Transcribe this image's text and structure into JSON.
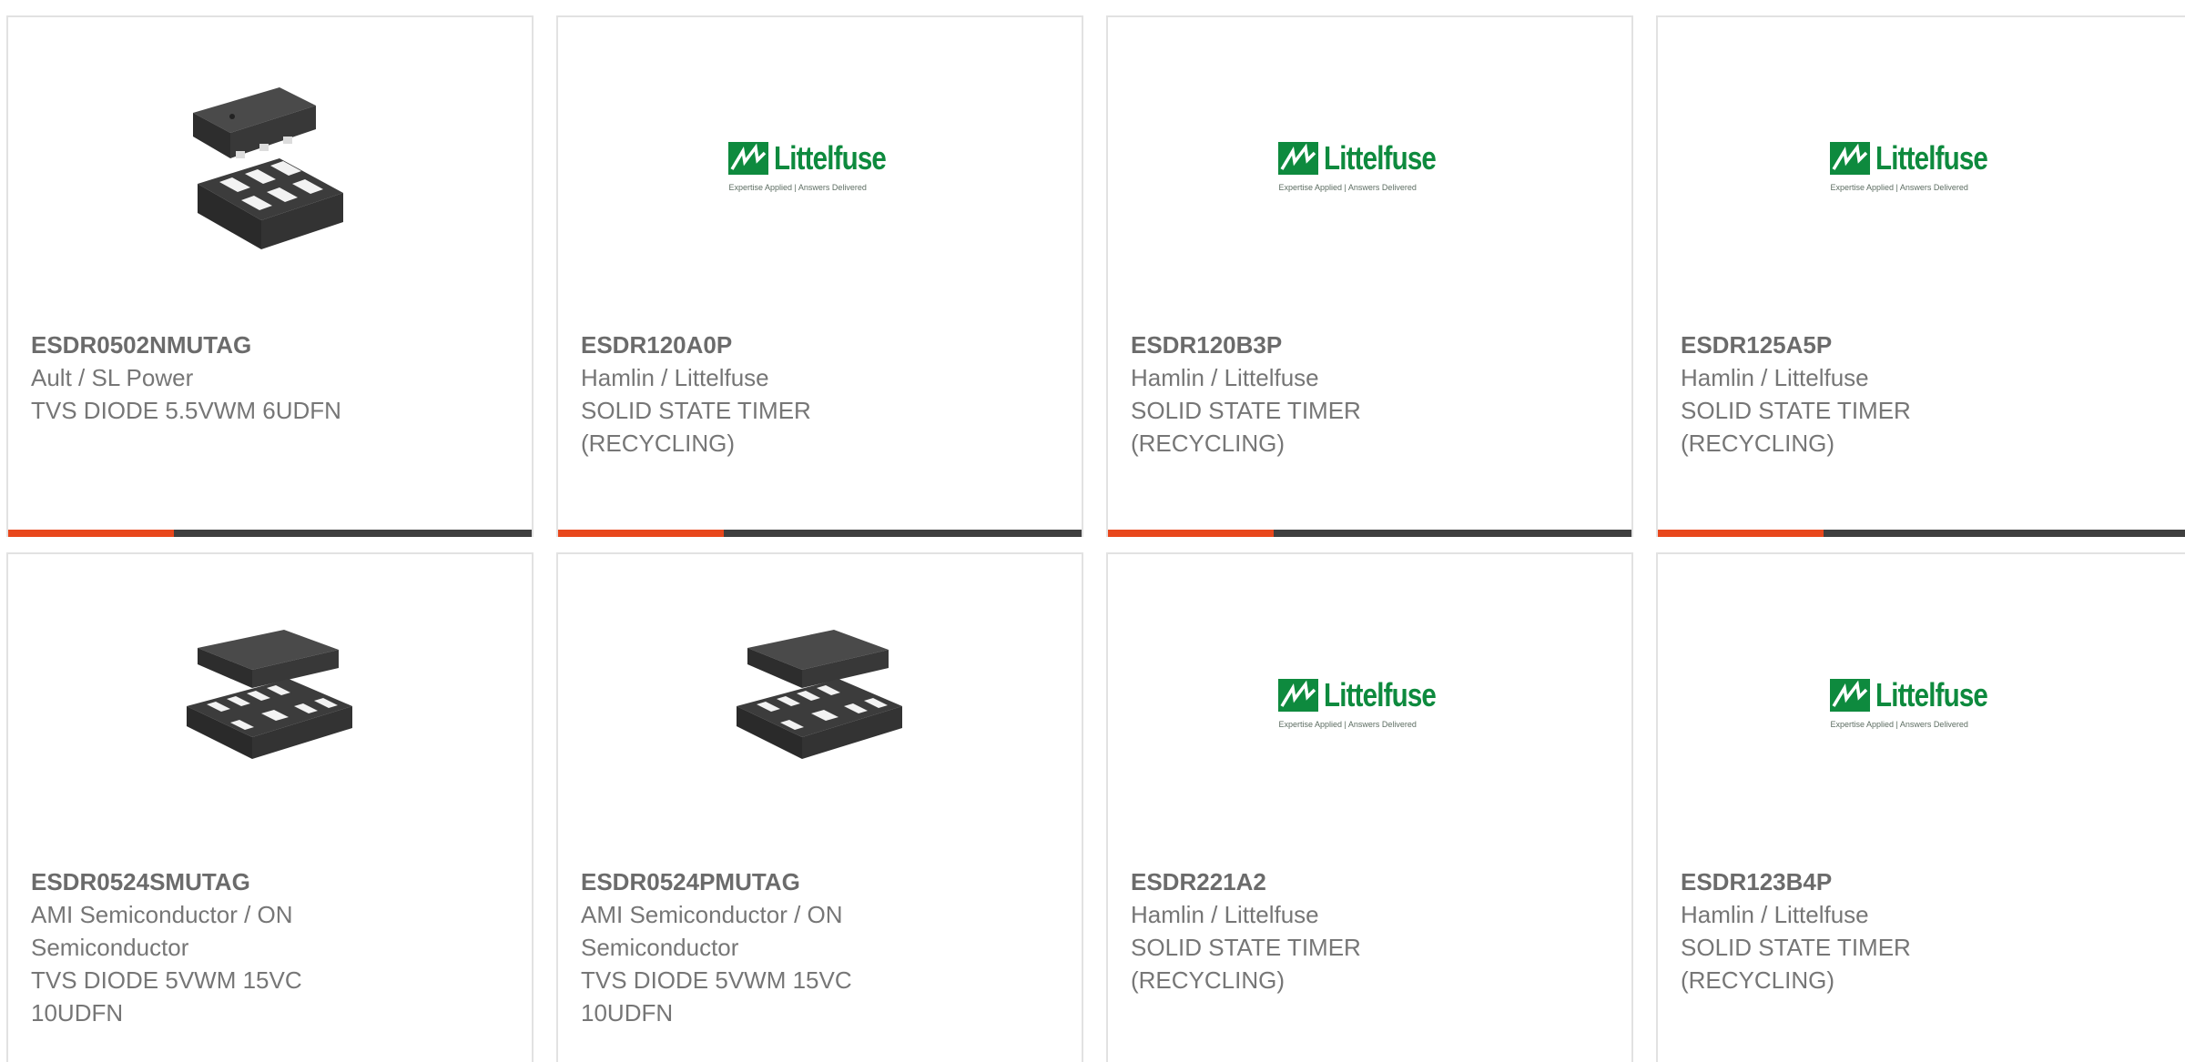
{
  "colors": {
    "accent": "#e8471c",
    "bar": "#3f3f3f",
    "brand_green": "#0e8a3e",
    "part_text": "#6b6b6b",
    "body_text": "#767676"
  },
  "logo": {
    "word": "Littelfuse",
    "tagline": "Expertise Applied | Answers Delivered",
    "registered": "®"
  },
  "products": [
    {
      "part": "ESDR0502NMUTAG",
      "manufacturer": "Ault / SL Power",
      "description": "TVS DIODE 5.5VWM 6UDFN",
      "image": "udfn6-package"
    },
    {
      "part": "ESDR120A0P",
      "manufacturer": "Hamlin / Littelfuse",
      "description": "SOLID STATE TIMER (RECYCLING)",
      "image": "littelfuse-logo"
    },
    {
      "part": "ESDR120B3P",
      "manufacturer": "Hamlin / Littelfuse",
      "description": "SOLID STATE TIMER (RECYCLING)",
      "image": "littelfuse-logo"
    },
    {
      "part": "ESDR125A5P",
      "manufacturer": "Hamlin / Littelfuse",
      "description": "SOLID STATE TIMER (RECYCLING)",
      "image": "littelfuse-logo"
    },
    {
      "part": "ESDR0524SMUTAG",
      "manufacturer": "AMI Semiconductor / ON Semiconductor",
      "description": "TVS DIODE 5VWM 15VC 10UDFN",
      "image": "udfn10-package"
    },
    {
      "part": "ESDR0524PMUTAG",
      "manufacturer": "AMI Semiconductor / ON Semiconductor",
      "description": "TVS DIODE 5VWM 15VC 10UDFN",
      "image": "udfn10-package"
    },
    {
      "part": "ESDR221A2",
      "manufacturer": "Hamlin / Littelfuse",
      "description": "SOLID STATE TIMER (RECYCLING)",
      "image": "littelfuse-logo"
    },
    {
      "part": "ESDR123B4P",
      "manufacturer": "Hamlin / Littelfuse",
      "description": "SOLID STATE TIMER (RECYCLING)",
      "image": "littelfuse-logo"
    }
  ]
}
